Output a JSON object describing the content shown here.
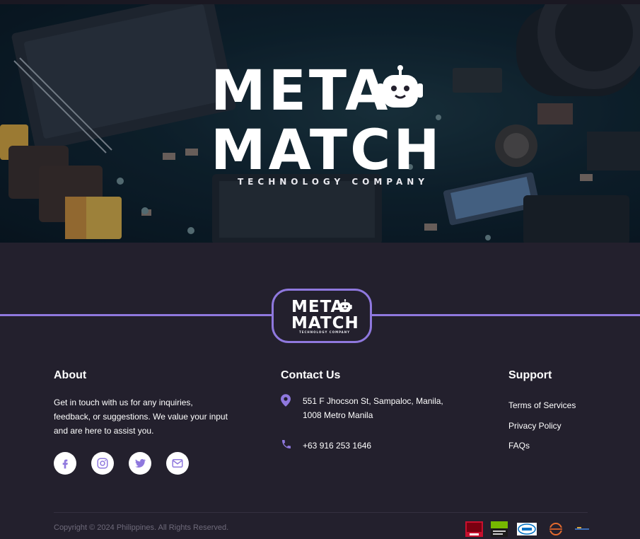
{
  "hero": {
    "logo_line1": "META",
    "logo_line2": "MATCH",
    "logo_tagline": "TECHNOLOGY COMPANY"
  },
  "footer_badge": {
    "line1": "META",
    "line2": "MATCH",
    "tagline": "TECHNOLOGY COMPANY"
  },
  "about": {
    "title": "About",
    "text": "Get in touch with us for any inquiries, feedback, or suggestions. We value your input and are here to assist you.",
    "socials": [
      {
        "name": "facebook-icon"
      },
      {
        "name": "instagram-icon"
      },
      {
        "name": "twitter-icon"
      },
      {
        "name": "email-icon"
      }
    ]
  },
  "contact": {
    "title": "Contact Us",
    "address": "551 F Jhocson St, Sampaloc, Manila, 1008 Metro Manila",
    "phone": "+63 916 253 1646"
  },
  "support": {
    "title": "Support",
    "links": [
      "Terms of Services",
      "Privacy Policy",
      "FAQs"
    ]
  },
  "footer": {
    "copyright": "Copyright © 2024 Philippines. All Rights Reserved.",
    "brands": [
      "radeon-logo",
      "nvidia-geforce-logo",
      "intel-logo",
      "ryzen-logo",
      "amd-logo"
    ]
  },
  "colors": {
    "background": "#23202d",
    "accent": "#8f78de",
    "text": "#ffffff",
    "muted": "#6e6a7a"
  }
}
